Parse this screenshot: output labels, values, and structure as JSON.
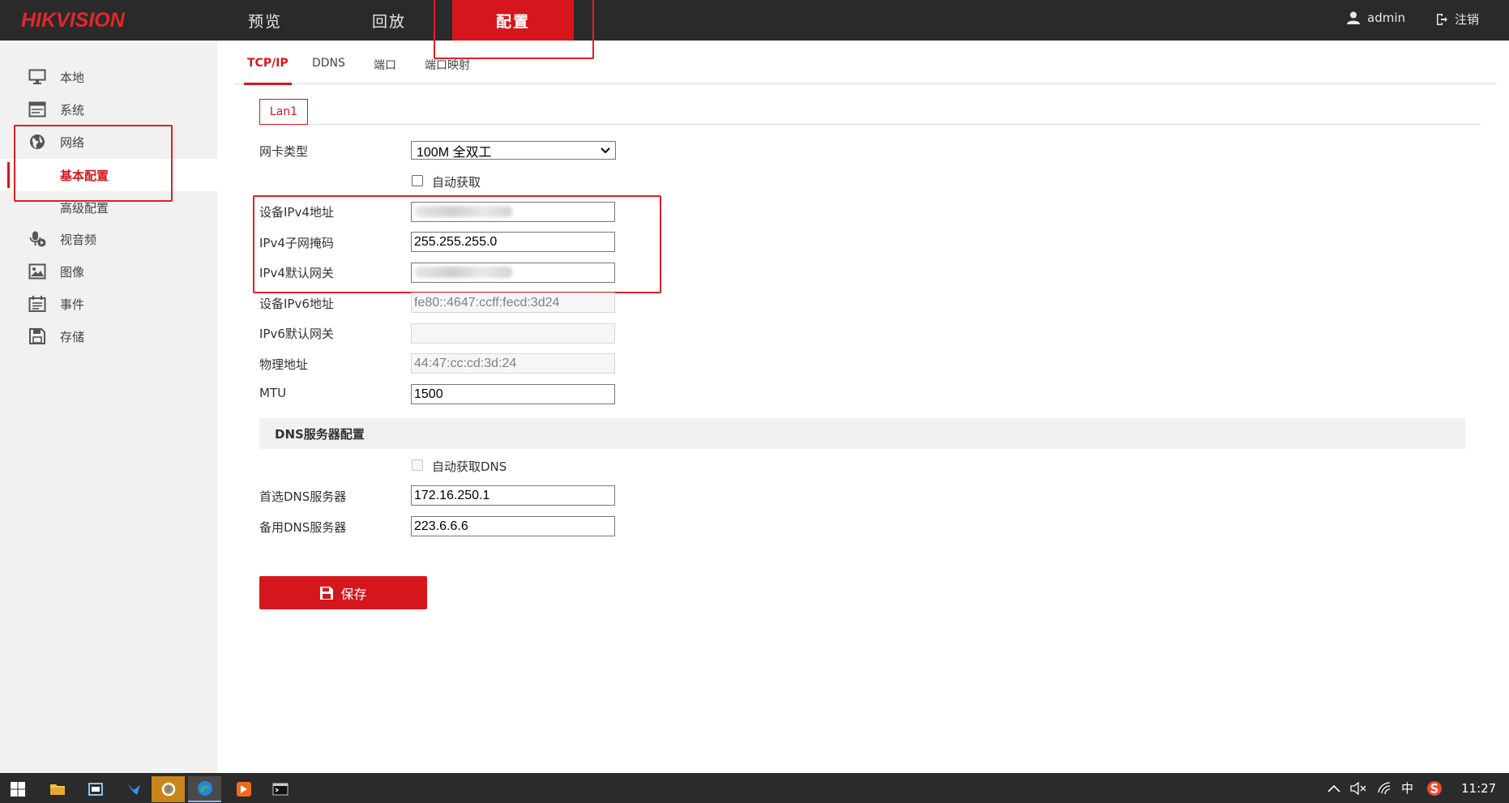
{
  "header": {
    "logo": "HIKVISION",
    "nav": [
      "预览",
      "回放",
      "配置"
    ],
    "user": "admin",
    "logout": "注销"
  },
  "sidebar": {
    "items": [
      {
        "label": "本地",
        "icon": "monitor-icon"
      },
      {
        "label": "系统",
        "icon": "system-icon"
      },
      {
        "label": "网络",
        "icon": "globe-icon"
      },
      {
        "label": "视音频",
        "icon": "mic-icon"
      },
      {
        "label": "图像",
        "icon": "image-icon"
      },
      {
        "label": "事件",
        "icon": "calendar-icon"
      },
      {
        "label": "存储",
        "icon": "save-icon"
      }
    ],
    "sub": [
      "基本配置",
      "高级配置"
    ]
  },
  "tabs": [
    "TCP/IP",
    "DDNS",
    "端口",
    "端口映射"
  ],
  "lan_tab": "Lan1",
  "form": {
    "nic_type_label": "网卡类型",
    "nic_type_value": "100M 全双工",
    "auto_get_label": "自动获取",
    "ipv4_label": "设备IPv4地址",
    "ipv4_value": "",
    "mask_label": "IPv4子网掩码",
    "mask_value": "255.255.255.0",
    "gateway_label": "IPv4默认网关",
    "gateway_value": "",
    "ipv6_label": "设备IPv6地址",
    "ipv6_value": "fe80::4647:ccff:fecd:3d24",
    "ipv6_gw_label": "IPv6默认网关",
    "ipv6_gw_value": "",
    "mac_label": "物理地址",
    "mac_value": "44:47:cc:cd:3d:24",
    "mtu_label": "MTU",
    "mtu_value": "1500"
  },
  "dns": {
    "section_title": "DNS服务器配置",
    "auto_dns_label": "自动获取DNS",
    "preferred_label": "首选DNS服务器",
    "preferred_value": "172.16.250.1",
    "alternate_label": "备用DNS服务器",
    "alternate_value": "223.6.6.6"
  },
  "save_label": "保存",
  "taskbar": {
    "ime": "中",
    "clock": "11:27"
  },
  "colors": {
    "accent": "#d5161c",
    "header_bg": "#2a2a2a",
    "sidebar_bg": "#f1f1f1",
    "highlight_box": "#e21f26"
  }
}
